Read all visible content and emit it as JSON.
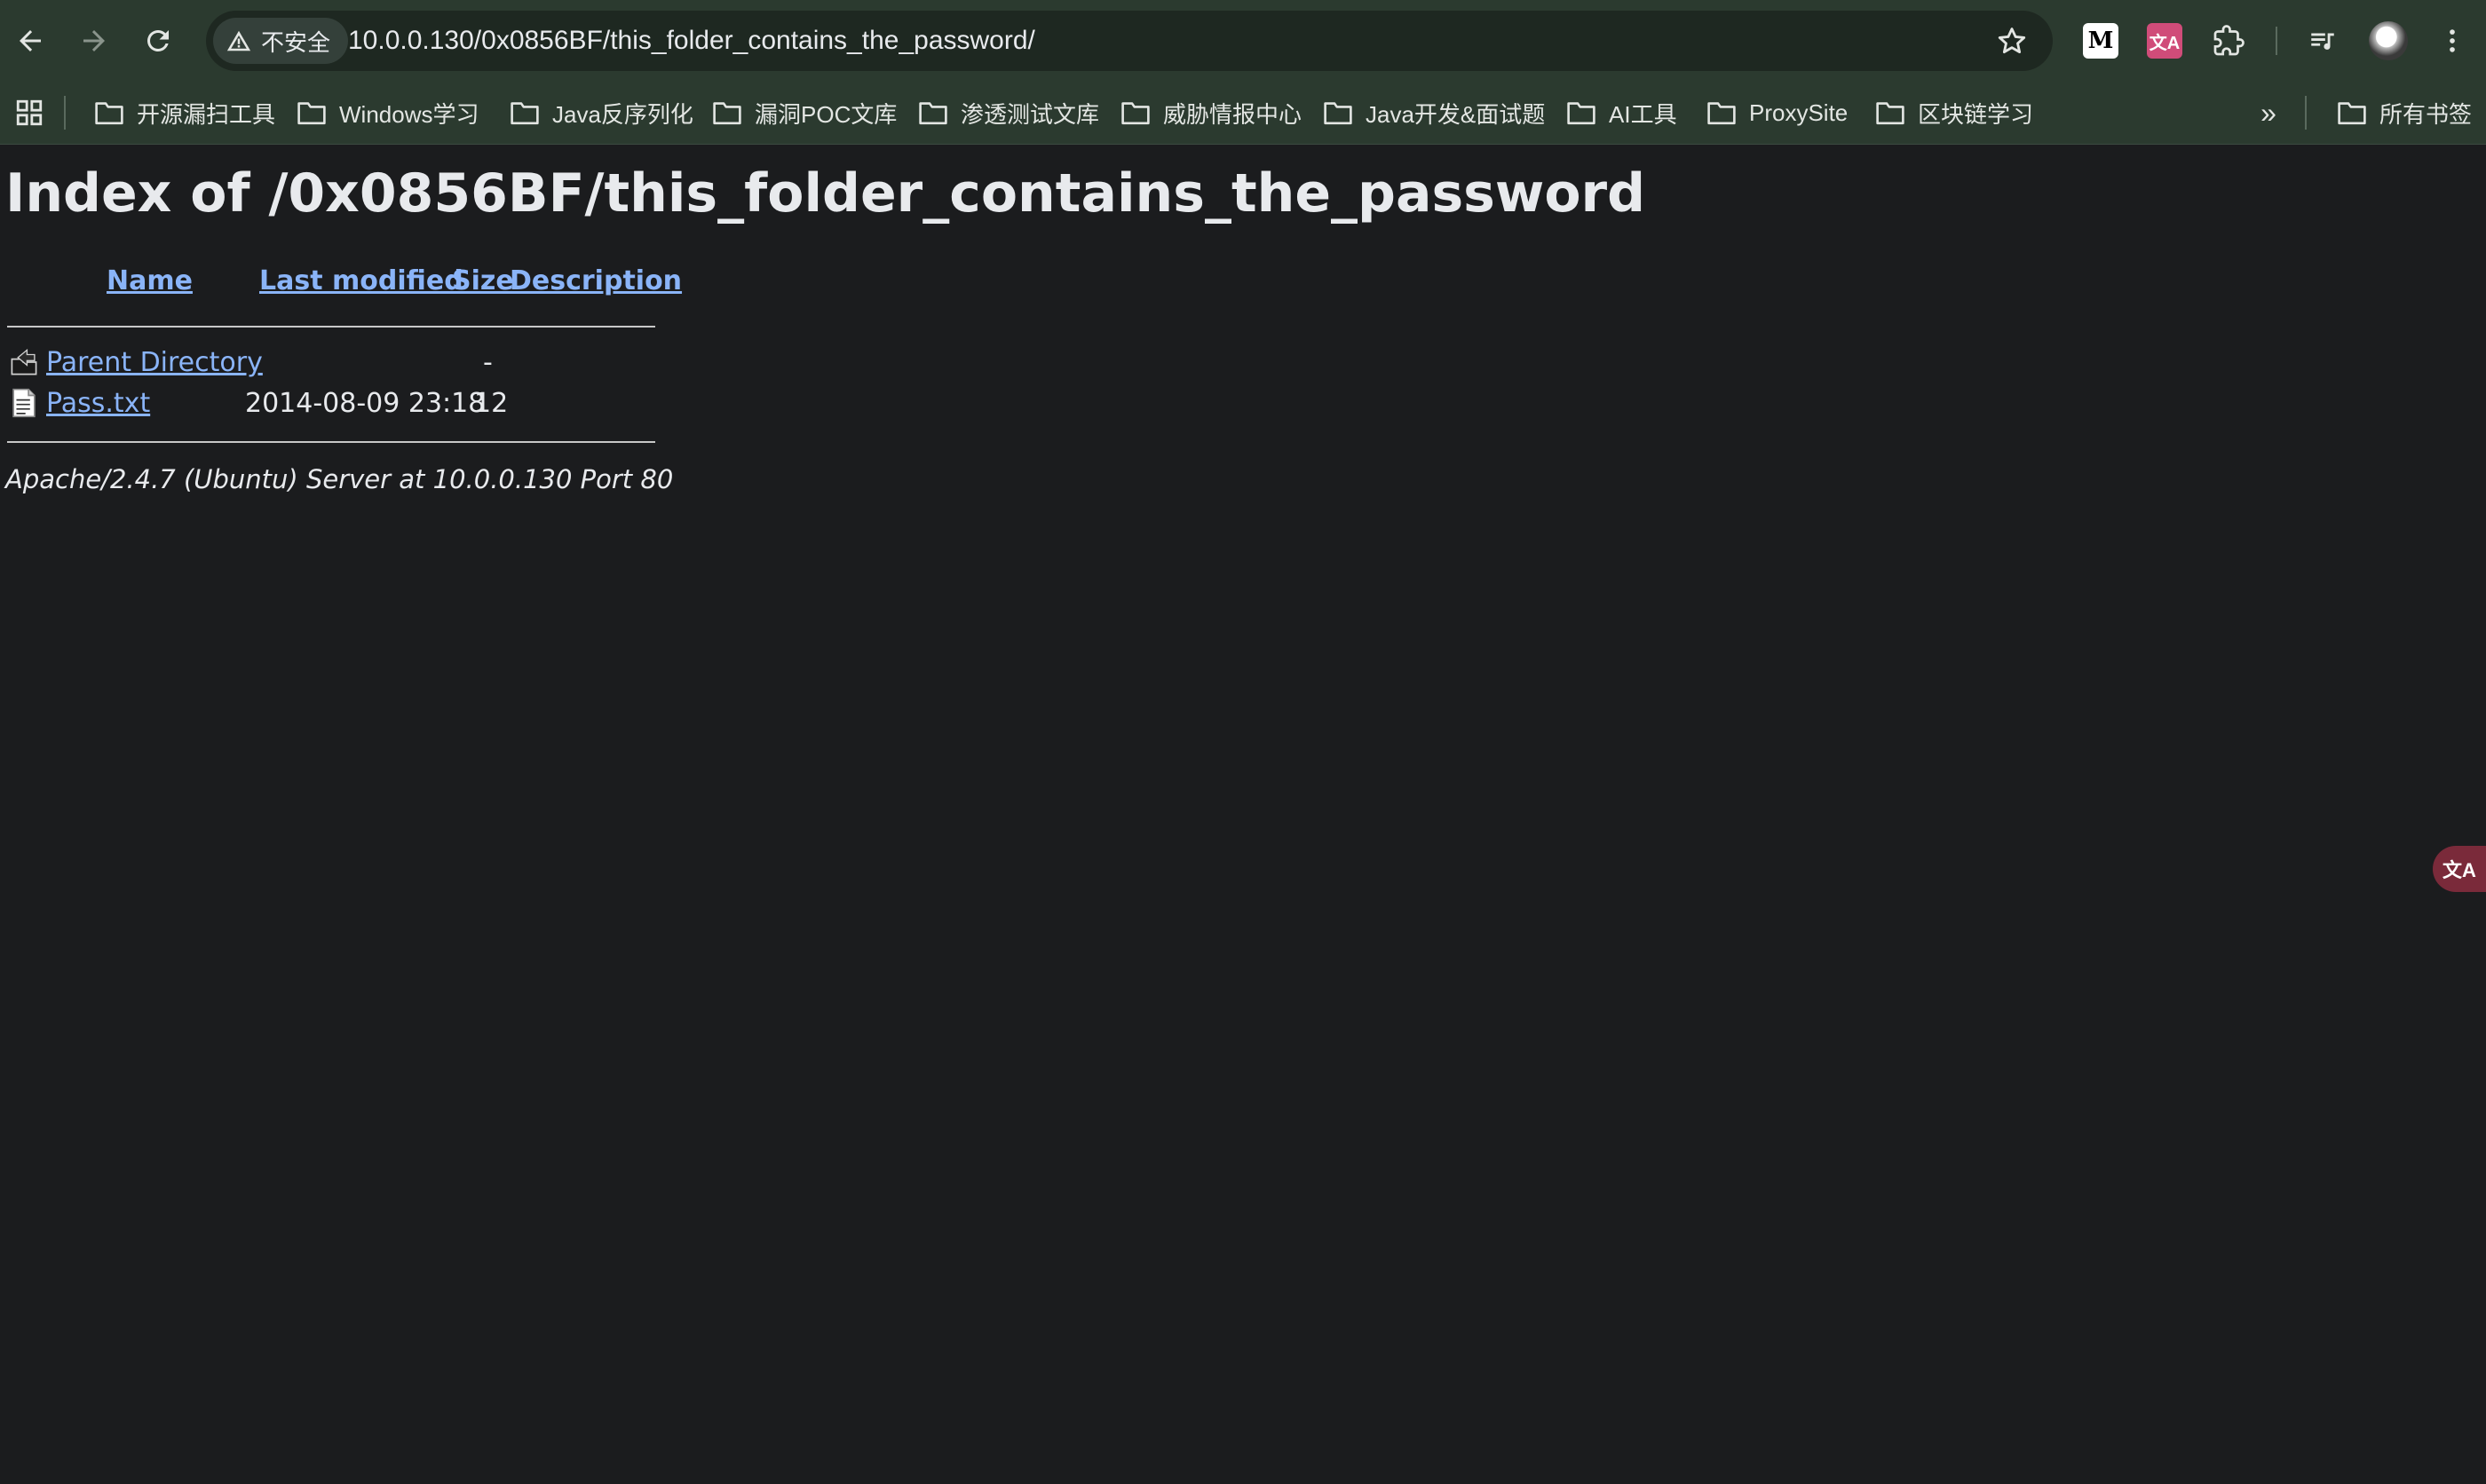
{
  "browser": {
    "security_label": "不安全",
    "url": "10.0.0.130/0x0856BF/this_folder_contains_the_password/",
    "icons": [
      "back-arrow-icon",
      "forward-arrow-icon",
      "reload-icon",
      "warning-icon",
      "star-icon",
      "extensions-puzzle-icon",
      "media-control-icon",
      "kebab-menu-icon"
    ],
    "extension_m_label": "M",
    "extension_translate_label": "文A"
  },
  "bookmarks": {
    "items": [
      {
        "label": "开源漏扫工具"
      },
      {
        "label": "Windows学习"
      },
      {
        "label": "Java反序列化"
      },
      {
        "label": "漏洞POC文库"
      },
      {
        "label": "渗透测试文库"
      },
      {
        "label": "威胁情报中心"
      },
      {
        "label": "Java开发&面试题"
      },
      {
        "label": "AI工具"
      },
      {
        "label": "ProxySite"
      },
      {
        "label": "区块链学习"
      }
    ],
    "more_label": "»",
    "all_bookmarks_label": "所有书签"
  },
  "page": {
    "title": "Index of /0x0856BF/this_folder_contains_the_password",
    "columns": {
      "name": "Name",
      "last_modified": "Last modified",
      "size": "Size",
      "description": "Description"
    },
    "rows": [
      {
        "icon": "back-folder-icon",
        "name": "Parent Directory",
        "last_modified": "",
        "size": "-",
        "description": ""
      },
      {
        "icon": "text-file-icon",
        "name": "Pass.txt",
        "last_modified": "2014-08-09 23:18",
        "size": "12",
        "description": ""
      }
    ],
    "address": "Apache/2.4.7 (Ubuntu) Server at 10.0.0.130 Port 80"
  },
  "floating_translate_label": "文A"
}
